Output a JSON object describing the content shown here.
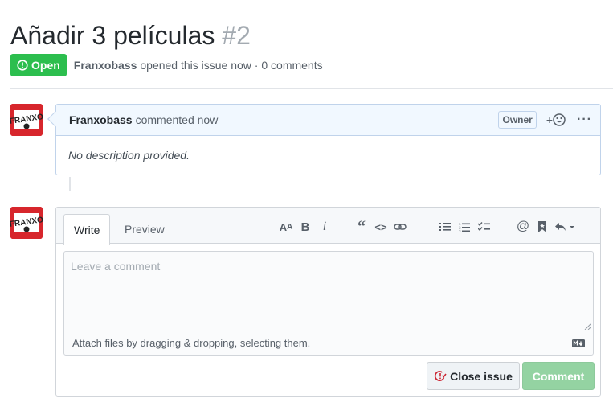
{
  "issue": {
    "title": "Añadir 3 películas",
    "number": "#2",
    "status": "Open",
    "author": "Franxobass",
    "meta_text": "opened this issue now · 0 comments"
  },
  "comment": {
    "author": "Franxobass",
    "action": "commented now",
    "role_badge": "Owner",
    "reaction_label": "+",
    "reaction_icon": "smiley-icon",
    "more_label": "···",
    "body": "No description provided."
  },
  "avatar": {
    "text": "FRANXO",
    "colors": {
      "background": "#ffffff",
      "accent": "#d7262c",
      "dark": "#222222"
    }
  },
  "editor": {
    "tabs": [
      {
        "label": "Write",
        "active": true
      },
      {
        "label": "Preview",
        "active": false
      }
    ],
    "toolbar_icons": [
      "text-size-icon",
      "bold-icon",
      "italic-icon",
      "quote-icon",
      "code-icon",
      "link-icon",
      "bulleted-list-icon",
      "numbered-list-icon",
      "task-list-icon",
      "mention-icon",
      "bookmark-icon",
      "reply-icon"
    ],
    "placeholder": "Leave a comment",
    "attach_text": "Attach files by dragging & dropping, selecting them.",
    "markdown_icon": "markdown-icon"
  },
  "actions": {
    "close_issue": "Close issue",
    "comment": "Comment"
  },
  "colors": {
    "open_badge": "#2cbe4e",
    "comment_header_bg": "#f1f8ff",
    "comment_button": "#94d3a2",
    "close_icon": "#cb2431"
  }
}
